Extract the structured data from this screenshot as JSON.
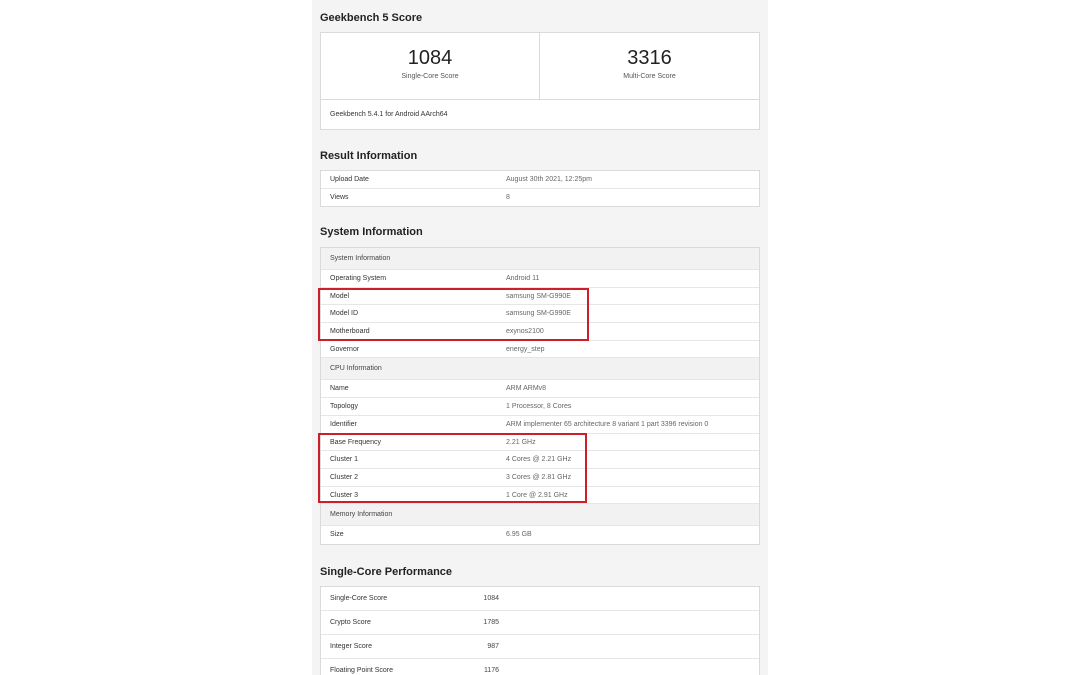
{
  "geekbench_score": {
    "title": "Geekbench 5 Score",
    "single_core": {
      "value": "1084",
      "label": "Single-Core Score"
    },
    "multi_core": {
      "value": "3316",
      "label": "Multi-Core Score"
    },
    "version": "Geekbench 5.4.1 for Android AArch64"
  },
  "result_information": {
    "title": "Result Information",
    "rows": [
      {
        "key": "Upload Date",
        "value": "August 30th 2021, 12:25pm"
      },
      {
        "key": "Views",
        "value": "8"
      }
    ]
  },
  "system_information": {
    "title": "System Information",
    "system_header": "System Information",
    "system_rows": [
      {
        "key": "Operating System",
        "value": "Android 11"
      },
      {
        "key": "Model",
        "value": "samsung SM-G990E"
      },
      {
        "key": "Model ID",
        "value": "samsung SM-G990E"
      },
      {
        "key": "Motherboard",
        "value": "exynos2100"
      },
      {
        "key": "Governor",
        "value": "energy_step"
      }
    ],
    "cpu_header": "CPU Information",
    "cpu_rows": [
      {
        "key": "Name",
        "value": "ARM ARMv8"
      },
      {
        "key": "Topology",
        "value": "1 Processor, 8 Cores"
      },
      {
        "key": "Identifier",
        "value": "ARM implementer 65 architecture 8 variant 1 part 3396 revision 0"
      },
      {
        "key": "Base Frequency",
        "value": "2.21 GHz"
      },
      {
        "key": "Cluster 1",
        "value": "4 Cores @ 2.21 GHz"
      },
      {
        "key": "Cluster 2",
        "value": "3 Cores @ 2.81 GHz"
      },
      {
        "key": "Cluster 3",
        "value": "1 Core @ 2.91 GHz"
      }
    ],
    "memory_header": "Memory Information",
    "memory_rows": [
      {
        "key": "Size",
        "value": "6.95 GB"
      }
    ]
  },
  "single_core_performance": {
    "title": "Single-Core Performance",
    "rows": [
      {
        "key": "Single-Core Score",
        "value": "1084"
      },
      {
        "key": "Crypto Score",
        "value": "1785"
      },
      {
        "key": "Integer Score",
        "value": "987"
      },
      {
        "key": "Floating Point Score",
        "value": "1176"
      }
    ]
  },
  "colors": {
    "highlight": "#cc1f2a",
    "panel": "#f4f4f4",
    "border": "#dadada"
  }
}
